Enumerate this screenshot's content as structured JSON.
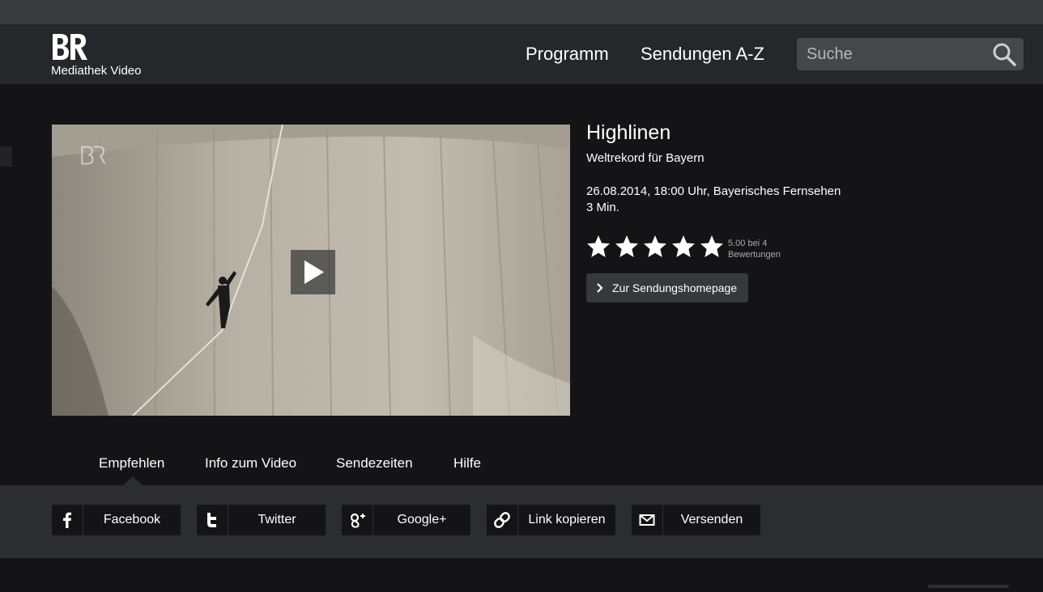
{
  "header": {
    "logo_text": "BR",
    "logo_subtitle": "Mediathek Video",
    "nav": [
      {
        "label": "Programm"
      },
      {
        "label": "Sendungen A-Z"
      }
    ],
    "search": {
      "placeholder": "Suche",
      "value": ""
    }
  },
  "video": {
    "watermark": "BR",
    "title": "Highlinen",
    "subtitle": "Weltrekord für Bayern",
    "broadcast": "26.08.2014, 18:00 Uhr, Bayerisches Fernsehen",
    "duration": "3 Min.",
    "rating": {
      "score": 5.0,
      "max": 5,
      "text_line1": "5.00 bei 4",
      "text_line2": "Bewertungen"
    },
    "homepage_button": "Zur Sendungshomepage"
  },
  "tabs": [
    {
      "label": "Empfehlen",
      "active": true
    },
    {
      "label": "Info zum Video"
    },
    {
      "label": "Sendezeiten"
    },
    {
      "label": "Hilfe"
    }
  ],
  "share": [
    {
      "label": "Facebook",
      "icon": "facebook-icon"
    },
    {
      "label": "Twitter",
      "icon": "twitter-icon"
    },
    {
      "label": "Google+",
      "icon": "google-plus-icon"
    },
    {
      "label": "Link kopieren",
      "icon": "link-icon"
    },
    {
      "label": "Versenden",
      "icon": "mail-icon"
    }
  ],
  "colors": {
    "header_bg": "#26272a",
    "page_bg": "#141416",
    "share_bar_bg": "#2c2d30",
    "text": "#ffffff"
  }
}
